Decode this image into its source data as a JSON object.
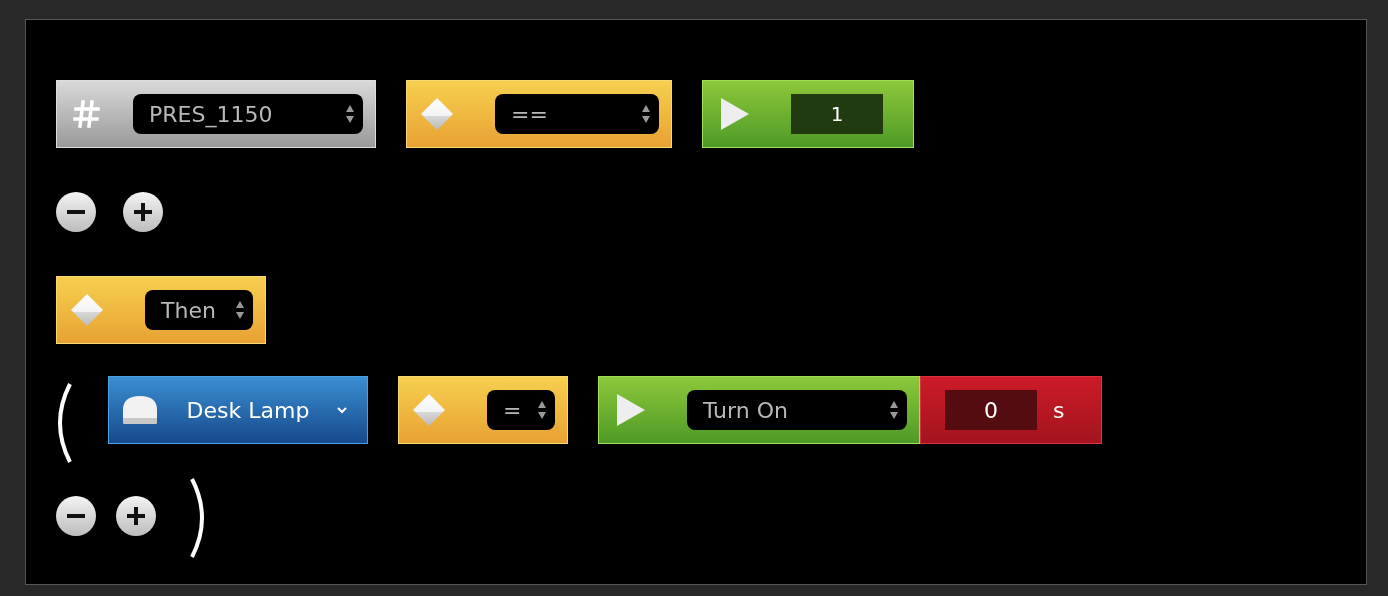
{
  "condition": {
    "blocks": [
      {
        "kind": "variable",
        "value": "PRES_1150"
      },
      {
        "kind": "operator",
        "value": "=="
      },
      {
        "kind": "number",
        "value": "1"
      }
    ]
  },
  "then_block": {
    "kind": "operator",
    "value": "Then"
  },
  "action": {
    "blocks": [
      {
        "kind": "device",
        "value": "Desk Lamp"
      },
      {
        "kind": "operator",
        "value": "="
      },
      {
        "kind": "command",
        "value": "Turn On"
      },
      {
        "kind": "delay",
        "value": "0",
        "unit": "s"
      }
    ]
  }
}
